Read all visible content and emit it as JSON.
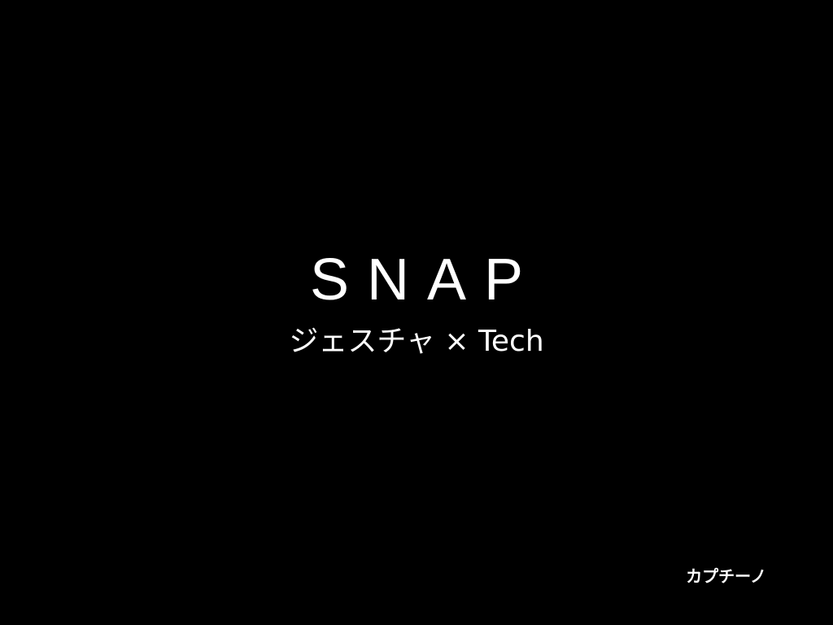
{
  "slide": {
    "title": "SNAP",
    "subtitle": "ジェスチャ × Tech",
    "author": "カプチーノ"
  },
  "colors": {
    "background": "#000000",
    "text": "#ffffff"
  }
}
